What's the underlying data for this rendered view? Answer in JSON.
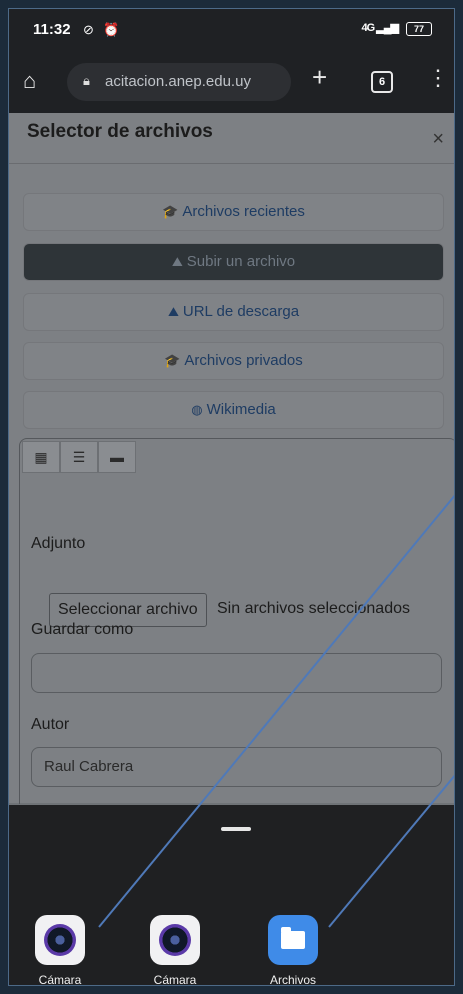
{
  "status": {
    "time": "11:32",
    "network": "4G",
    "battery": "77"
  },
  "browser": {
    "url": "acitacion.anep.edu.uy",
    "tab_count": "6"
  },
  "dialog": {
    "title": "Selector de archivos",
    "close": "×",
    "repositories": [
      {
        "label": "Archivos recientes",
        "icon": "moodle-icon"
      },
      {
        "label": "Subir un archivo",
        "icon": "upload-icon",
        "active": true
      },
      {
        "label": "URL de descarga",
        "icon": "url-icon"
      },
      {
        "label": "Archivos privados",
        "icon": "moodle-icon"
      },
      {
        "label": "Wikimedia",
        "icon": "globe-icon"
      }
    ],
    "view_buttons": [
      "grid-icon",
      "list-icon",
      "folder-icon"
    ],
    "form": {
      "attachment_label": "Adjunto",
      "choose_file_button": "Seleccionar archivo",
      "no_file_text": "Sin archivos seleccionados",
      "save_as_label": "Guardar como",
      "save_as_value": "",
      "author_label": "Autor",
      "author_value": "Raul Cabrera"
    }
  },
  "sheet": {
    "apps": [
      {
        "label": "Cámara",
        "icon": "camera-icon"
      },
      {
        "label": "Cámara",
        "icon": "camera-icon"
      },
      {
        "label": "Archivos",
        "icon": "files-folder-icon"
      }
    ]
  },
  "colors": {
    "annotation_line": "#4f79b8",
    "active_repo_bg": "#2e3438",
    "files_app": "#3f8be8"
  }
}
